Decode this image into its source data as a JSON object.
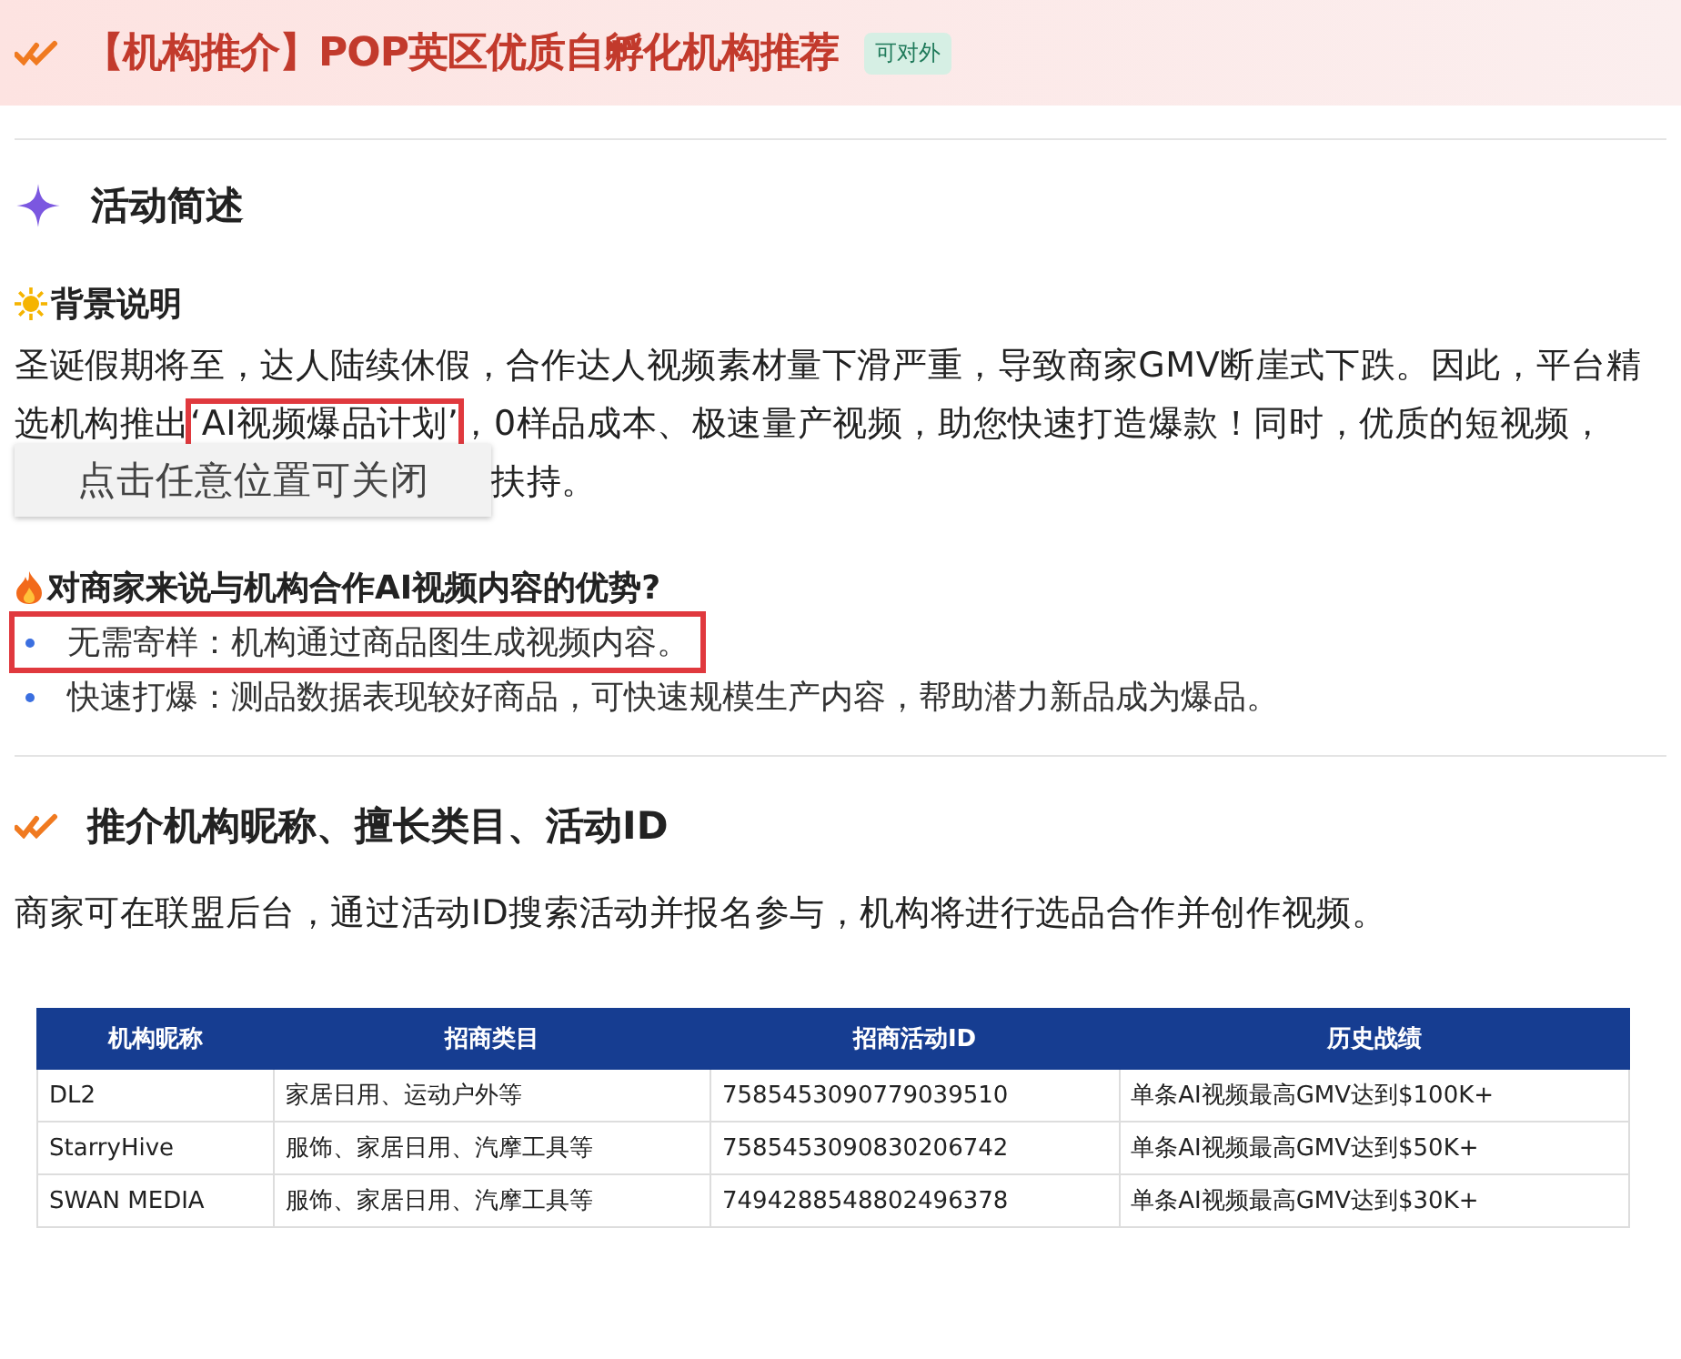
{
  "header": {
    "title": "【机构推介】POP英区优质自孵化机构推荐",
    "badge": "可对外"
  },
  "summary": {
    "heading": "活动简述",
    "background": {
      "heading": "背景说明",
      "text_before": "圣诞假期将至，达人陆续休假，合作达人视频素材量下滑严重，导致商家GMV断崖式下跌。因此，平台精选机构推出",
      "highlight": "‘AI视频爆品计划’",
      "highlight_boxed": true,
      "text_after": "，0样品成本、极速量产视频，助您快速打造爆款！同时，优质的短视频，",
      "text_tail": "扶持。"
    },
    "advantages": {
      "heading": "对商家来说与机构合作AI视频内容的优势?",
      "items": [
        {
          "text": "无需寄样：机构通过商品图生成视频内容。",
          "highlighted": true
        },
        {
          "text": "快速打爆：测品数据表现较好商品，可快速规模生产内容，帮助潜力新品成为爆品。",
          "highlighted": false
        }
      ]
    }
  },
  "toast": "点击任意位置可关闭",
  "agencies": {
    "heading": "推介机构昵称、擅长类目、活动ID",
    "intro": "商家可在联盟后台，通过活动ID搜索活动并报名参与，机构将进行选品合作并创作视频。",
    "table": {
      "columns": [
        "机构昵称",
        "招商类目",
        "招商活动ID",
        "历史战绩"
      ],
      "rows": [
        [
          "DL2",
          "家居日用、运动户外等",
          "7585453090779039510",
          "单条AI视频最高GMV达到$100K+"
        ],
        [
          "StarryHive",
          "服饰、家居日用、汽摩工具等",
          "7585453090830206742",
          "单条AI视频最高GMV达到$50K+"
        ],
        [
          "SWAN MEDIA",
          "服饰、家居日用、汽摩工具等",
          "7494288548802496378",
          "单条AI视频最高GMV达到$30K+"
        ]
      ]
    }
  }
}
